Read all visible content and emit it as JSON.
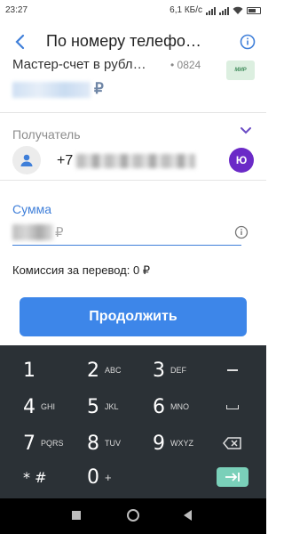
{
  "status_bar": {
    "time": "23:27",
    "speed": "6,1 КБ/с"
  },
  "app_bar": {
    "title": "По номеру телефо…",
    "back_icon": "arrow-left-icon",
    "info_icon": "info-circle-icon"
  },
  "account": {
    "name": "Мастер-счет в рубл…",
    "digits": "• 0824",
    "currency": "₽",
    "card_label": "МИР"
  },
  "recipient": {
    "label": "Получатель",
    "phone_prefix": "+7",
    "bank_badge": "Ю"
  },
  "amount": {
    "label": "Сумма",
    "currency": "₽"
  },
  "commission": "Комиссия за перевод: 0 ₽",
  "continue_label": "Продолжить",
  "keyboard": {
    "keys": [
      {
        "digit": "1",
        "letters": ""
      },
      {
        "digit": "2",
        "letters": "ABC"
      },
      {
        "digit": "3",
        "letters": "DEF"
      },
      {
        "digit": "4",
        "letters": "GHI"
      },
      {
        "digit": "5",
        "letters": "JKL"
      },
      {
        "digit": "6",
        "letters": "MNO"
      },
      {
        "digit": "7",
        "letters": "PQRS"
      },
      {
        "digit": "8",
        "letters": "TUV"
      },
      {
        "digit": "9",
        "letters": "WXYZ"
      },
      {
        "digit": "* #",
        "letters": ""
      },
      {
        "digit": "0",
        "letters": "+"
      }
    ]
  },
  "colors": {
    "accent": "#3d86e9",
    "keyboard_bg": "#2b3136",
    "enter_key": "#7ad0b9",
    "bank_badge": "#6b2ac7"
  }
}
